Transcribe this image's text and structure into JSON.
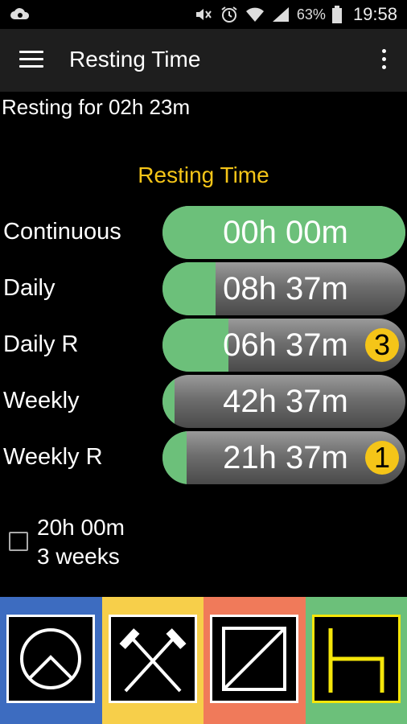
{
  "status_bar": {
    "battery_percent": "63%",
    "time": "19:58",
    "icons": [
      "cloud-icon",
      "mute-icon",
      "alarm-icon",
      "wifi-icon",
      "signal-icon",
      "battery-icon"
    ]
  },
  "app_bar": {
    "title": "Resting Time",
    "menu_icon": "hamburger-menu-icon",
    "overflow_icon": "more-vert-icon"
  },
  "resting_status": "Resting for 02h 23m",
  "section_title": "Resting Time",
  "rows": [
    {
      "label": "Continuous",
      "value": "00h 00m",
      "progress": 1.0,
      "badge": ""
    },
    {
      "label": "Daily",
      "value": "08h 37m",
      "progress": 0.22,
      "badge": ""
    },
    {
      "label": "Daily R",
      "value": "06h 37m",
      "progress": 0.27,
      "badge": "3"
    },
    {
      "label": "Weekly",
      "value": "42h 37m",
      "progress": 0.05,
      "badge": ""
    },
    {
      "label": "Weekly R",
      "value": "21h 37m",
      "progress": 0.1,
      "badge": "1"
    }
  ],
  "checkbox": {
    "checked": false,
    "line1": "20h 00m",
    "line2": "3 weeks"
  },
  "tiles": [
    {
      "name": "rest-mode-tile",
      "icon": "bed-rest-icon",
      "color": "#3d6cc0",
      "border": "#ffffff"
    },
    {
      "name": "work-mode-tile",
      "icon": "crossed-hammers-icon",
      "color": "#f7cf4a",
      "border": "#ffffff"
    },
    {
      "name": "availability-mode-tile",
      "icon": "availability-square-icon",
      "color": "#f07a5a",
      "border": "#ffffff"
    },
    {
      "name": "driving-mode-tile",
      "icon": "seat-icon",
      "color": "#6cc07a",
      "border": "#f5e60a"
    }
  ],
  "colors": {
    "accent": "#f5c518",
    "bar_fill": "#6cc07a",
    "app_bar_bg": "#1e1e1e",
    "background": "#000000"
  }
}
